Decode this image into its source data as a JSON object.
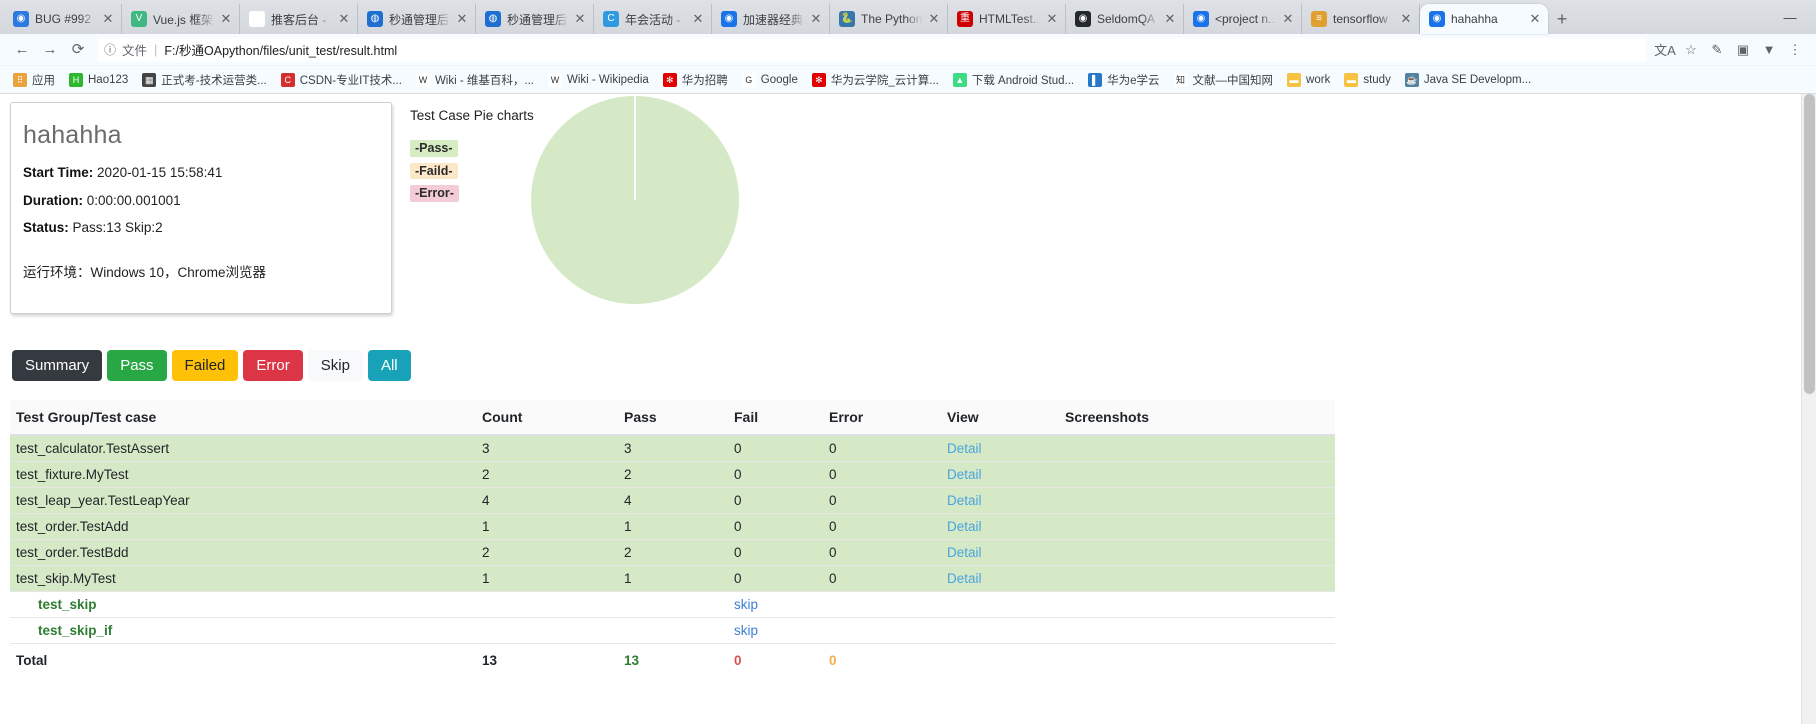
{
  "browser": {
    "tabs": [
      {
        "title": "BUG #992",
        "icon": "globe-icon",
        "color": "#2a7ae2",
        "glyph": "◉",
        "active": false
      },
      {
        "title": "Vue.js 框架",
        "icon": "vuejs-icon",
        "color": "#41b883",
        "glyph": "V",
        "active": false
      },
      {
        "title": "推客后台 -",
        "icon": "page-icon",
        "color": "#ffffff",
        "glyph": "♗",
        "active": false
      },
      {
        "title": "秒通管理后...",
        "icon": "app-icon",
        "color": "#1f6fd0",
        "glyph": "◍",
        "active": false
      },
      {
        "title": "秒通管理后...",
        "icon": "app-icon",
        "color": "#1f6fd0",
        "glyph": "◍",
        "active": false
      },
      {
        "title": "年会活动 -",
        "icon": "chat-icon",
        "color": "#2f9ae0",
        "glyph": "C",
        "active": false
      },
      {
        "title": "加速器经典...",
        "icon": "globe-icon",
        "color": "#1a73e8",
        "glyph": "◉",
        "active": false
      },
      {
        "title": "The Python",
        "icon": "python-icon",
        "color": "#3776ab",
        "glyph": "🐍",
        "active": false
      },
      {
        "title": "HTMLTest...",
        "icon": "test-icon",
        "color": "#cc0000",
        "glyph": "重",
        "active": false
      },
      {
        "title": "SeldomQA",
        "icon": "github-icon",
        "color": "#24292e",
        "glyph": "◉",
        "active": false
      },
      {
        "title": "<project n...",
        "icon": "globe-icon",
        "color": "#1a73e8",
        "glyph": "◉",
        "active": false
      },
      {
        "title": "tensorflow",
        "icon": "doc-icon",
        "color": "#e0a030",
        "glyph": "≡",
        "active": false
      },
      {
        "title": "hahahha",
        "icon": "globe-icon",
        "color": "#1a73e8",
        "glyph": "◉",
        "active": true
      }
    ],
    "new_tab_label": "+",
    "window_controls": [
      "—",
      "☐",
      "✕"
    ],
    "nav": {
      "back": "←",
      "forward": "→",
      "reload": "⟳"
    },
    "omnibox": {
      "info_icon": "ⓘ",
      "scheme_label": "文件",
      "separator": "|",
      "url": "F:/秒通OApython/files/unit_test/result.html"
    },
    "toolbar_icons": [
      "translate-icon",
      "star-icon",
      "extension-icon",
      "cast-icon",
      "profile-icon",
      "menu-icon"
    ],
    "toolbar_glyphs": [
      "文A",
      "☆",
      "✎",
      "▣",
      "▼",
      "⋮"
    ],
    "bookmarks": [
      {
        "label": "应用",
        "icon": "apps-grid-icon",
        "color": "#e8a33d",
        "glyph": "⠿"
      },
      {
        "label": "Hao123",
        "icon": "hao123-icon",
        "color": "#2eb82e",
        "glyph": "H"
      },
      {
        "label": "正式考-技术运营类...",
        "icon": "page-icon",
        "color": "#444444",
        "glyph": "▦"
      },
      {
        "label": "CSDN-专业IT技术...",
        "icon": "csdn-icon",
        "color": "#d32f2f",
        "glyph": "C"
      },
      {
        "label": "Wiki - 维基百科，...",
        "icon": "wikipedia-icon",
        "color": "#ffffff",
        "glyph": "W"
      },
      {
        "label": "Wiki - Wikipedia",
        "icon": "wikipedia-icon",
        "color": "#ffffff",
        "glyph": "W"
      },
      {
        "label": "华为招聘",
        "icon": "huawei-icon",
        "color": "#e00000",
        "glyph": "✻"
      },
      {
        "label": "Google",
        "icon": "google-icon",
        "color": "#ffffff",
        "glyph": "G"
      },
      {
        "label": "华为云学院_云计算...",
        "icon": "huawei-icon",
        "color": "#e00000",
        "glyph": "✻"
      },
      {
        "label": "下载 Android Stud...",
        "icon": "android-icon",
        "color": "#3ddc84",
        "glyph": "▲"
      },
      {
        "label": "华为e学云",
        "icon": "elearning-icon",
        "color": "#2878c8",
        "glyph": "▌"
      },
      {
        "label": "文献—中国知网",
        "icon": "cnki-icon",
        "color": "#ffffff",
        "glyph": "知"
      },
      {
        "label": "work",
        "icon": "folder-icon",
        "color": "#f5c242",
        "glyph": "▬"
      },
      {
        "label": "study",
        "icon": "folder-icon",
        "color": "#f5c242",
        "glyph": "▬"
      },
      {
        "label": "Java SE Developm...",
        "icon": "java-icon",
        "color": "#5382a1",
        "glyph": "☕"
      }
    ]
  },
  "report": {
    "title": "hahahha",
    "start_time_label": "Start Time:",
    "start_time_value": "2020-01-15 15:58:41",
    "duration_label": "Duration:",
    "duration_value": "0:00:00.001001",
    "status_label": "Status:",
    "status_value": "Pass:13 Skip:2",
    "environment": "运行环境：Windows 10，Chrome浏览器"
  },
  "chart_data": {
    "type": "pie",
    "title": "Test Case Pie charts",
    "categories": [
      "Pass",
      "Faild",
      "Error"
    ],
    "values": [
      13,
      0,
      0
    ],
    "colors": [
      "#d6e9c6",
      "#fce8c8",
      "#f3ccd6"
    ],
    "legend": [
      {
        "label": "-Pass-",
        "color": "#d6ecc2"
      },
      {
        "label": "-Faild-",
        "color": "#fce8c8"
      },
      {
        "label": "-Error-",
        "color": "#f3ccd6"
      }
    ],
    "legend_position": "left",
    "total": 13
  },
  "filters": [
    {
      "label": "Summary",
      "style": "summary"
    },
    {
      "label": "Pass",
      "style": "pass"
    },
    {
      "label": "Failed",
      "style": "failed"
    },
    {
      "label": "Error",
      "style": "error"
    },
    {
      "label": "Skip",
      "style": "skip"
    },
    {
      "label": "All",
      "style": "all"
    }
  ],
  "table": {
    "headers": [
      "Test Group/Test case",
      "Count",
      "Pass",
      "Fail",
      "Error",
      "View",
      "Screenshots"
    ],
    "rows": [
      {
        "kind": "group",
        "name": "test_calculator.TestAssert",
        "count": "3",
        "pass": "3",
        "fail": "0",
        "error": "0",
        "view": "Detail",
        "shots": ""
      },
      {
        "kind": "group",
        "name": "test_fixture.MyTest",
        "count": "2",
        "pass": "2",
        "fail": "0",
        "error": "0",
        "view": "Detail",
        "shots": ""
      },
      {
        "kind": "group",
        "name": "test_leap_year.TestLeapYear",
        "count": "4",
        "pass": "4",
        "fail": "0",
        "error": "0",
        "view": "Detail",
        "shots": ""
      },
      {
        "kind": "group",
        "name": "test_order.TestAdd",
        "count": "1",
        "pass": "1",
        "fail": "0",
        "error": "0",
        "view": "Detail",
        "shots": ""
      },
      {
        "kind": "group",
        "name": "test_order.TestBdd",
        "count": "2",
        "pass": "2",
        "fail": "0",
        "error": "0",
        "view": "Detail",
        "shots": ""
      },
      {
        "kind": "group",
        "name": "test_skip.MyTest",
        "count": "1",
        "pass": "1",
        "fail": "0",
        "error": "0",
        "view": "Detail",
        "shots": ""
      },
      {
        "kind": "case",
        "name": "test_skip",
        "count": "",
        "pass": "",
        "fail": "skip",
        "error": "",
        "view": "",
        "shots": ""
      },
      {
        "kind": "case",
        "name": "test_skip_if",
        "count": "",
        "pass": "",
        "fail": "skip",
        "error": "",
        "view": "",
        "shots": ""
      }
    ],
    "total": {
      "name": "Total",
      "count": "13",
      "pass": "13",
      "fail": "0",
      "error": "0",
      "view": "",
      "shots": ""
    }
  }
}
